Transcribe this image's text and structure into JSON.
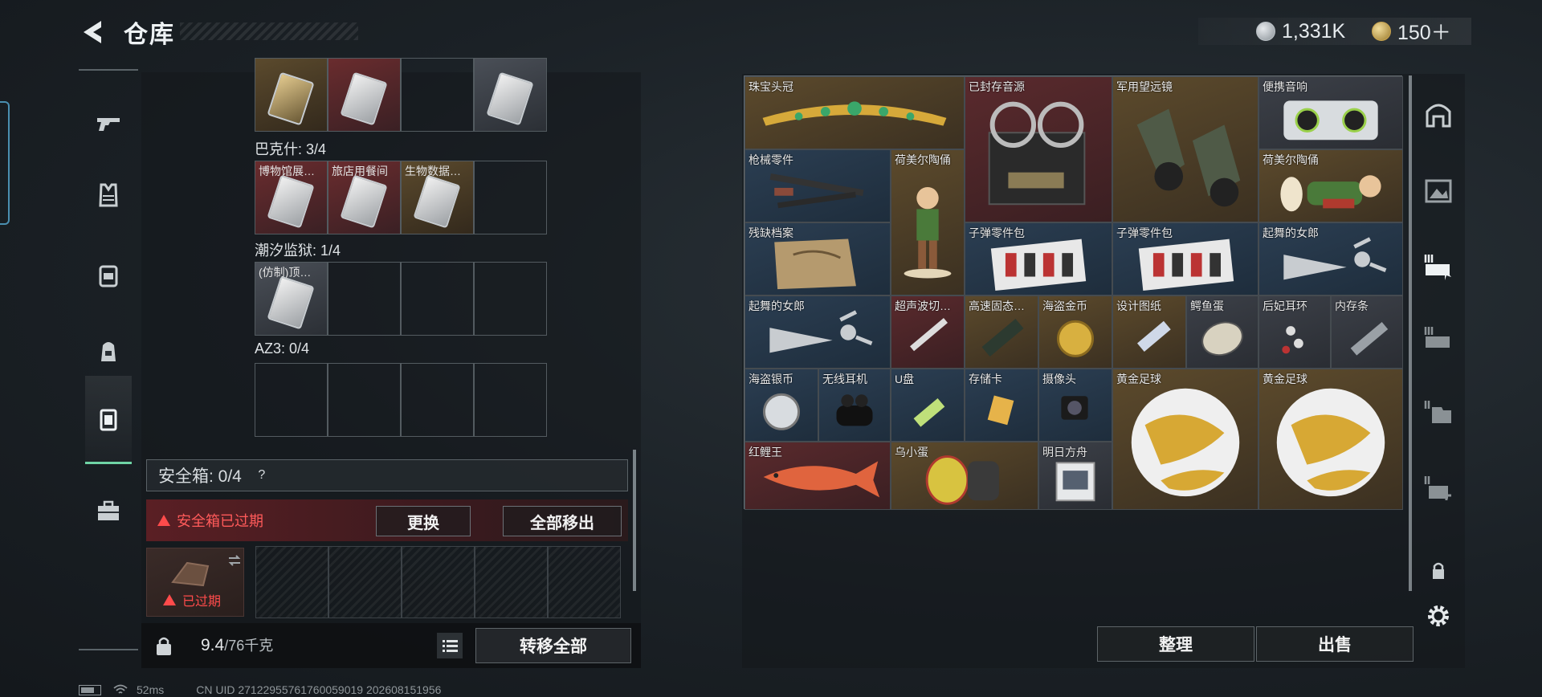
{
  "header": {
    "title": "仓库",
    "currency_silver": "1,331K",
    "currency_gold": "150＋"
  },
  "left_panel": {
    "rows": [
      {
        "title": "巴克什: 3/4",
        "slots": [
          {
            "label": "博物馆展…",
            "tone": "red"
          },
          {
            "label": "旅店用餐间",
            "tone": "red"
          },
          {
            "label": "生物数据…",
            "tone": "gold"
          },
          {
            "label": "",
            "tone": "empty"
          }
        ]
      },
      {
        "title": "潮汐监狱: 1/4",
        "slots": [
          {
            "label": "(仿制)顶…",
            "tone": "grey"
          },
          {
            "label": "",
            "tone": "empty"
          },
          {
            "label": "",
            "tone": "empty"
          },
          {
            "label": "",
            "tone": "empty"
          }
        ]
      },
      {
        "title": "AZ3: 0/4"
      }
    ],
    "safe_box_label": "安全箱: 0/4",
    "safe_box_help": "?",
    "expired_warning": "安全箱已过期",
    "replace_button": "更换",
    "move_all_button": "全部移出",
    "expired_tag": "已过期",
    "weight_current": "9.4",
    "weight_max": "/76千克",
    "transfer_all_button": "转移全部"
  },
  "warehouse": {
    "items": [
      {
        "label": "珠宝头冠",
        "tone": "gold",
        "icon": "tiara"
      },
      {
        "label": "已封存音源",
        "tone": "red",
        "icon": "reel-recorder"
      },
      {
        "label": "军用望远镜",
        "tone": "gold",
        "icon": "binoculars"
      },
      {
        "label": "便携音响",
        "tone": "grey",
        "icon": "boombox"
      },
      {
        "label": "枪械零件",
        "tone": "blue",
        "icon": "gun-parts"
      },
      {
        "label": "荷美尔陶俑",
        "tone": "gold",
        "icon": "figurine"
      },
      {
        "label": "荷美尔陶俑",
        "tone": "gold",
        "icon": "figurine-lying"
      },
      {
        "label": "残缺档案",
        "tone": "blue",
        "icon": "archive"
      },
      {
        "label": "子弹零件包",
        "tone": "blue",
        "icon": "bullet-parts"
      },
      {
        "label": "子弹零件包",
        "tone": "blue",
        "icon": "bullet-parts"
      },
      {
        "label": "起舞的女郎",
        "tone": "blue",
        "icon": "dancer"
      },
      {
        "label": "起舞的女郎",
        "tone": "blue",
        "icon": "dancer"
      },
      {
        "label": "超声波切…",
        "tone": "red",
        "icon": "cutter"
      },
      {
        "label": "高速固态…",
        "tone": "gold",
        "icon": "ssd"
      },
      {
        "label": "海盗金币",
        "tone": "gold",
        "icon": "gold-coin"
      },
      {
        "label": "设计图纸",
        "tone": "gold",
        "icon": "blueprint"
      },
      {
        "label": "鳄鱼蛋",
        "tone": "grey",
        "icon": "egg"
      },
      {
        "label": "后妃耳环",
        "tone": "grey",
        "icon": "earring"
      },
      {
        "label": "内存条",
        "tone": "grey",
        "icon": "ram"
      },
      {
        "label": "海盗银币",
        "tone": "blue",
        "icon": "silver-coin"
      },
      {
        "label": "无线耳机",
        "tone": "blue",
        "icon": "earbuds"
      },
      {
        "label": "U盘",
        "tone": "blue",
        "icon": "usb"
      },
      {
        "label": "存储卡",
        "tone": "blue",
        "icon": "sd-card"
      },
      {
        "label": "摄像头",
        "tone": "blue",
        "icon": "camera"
      },
      {
        "label": "黄金足球",
        "tone": "gold",
        "icon": "gold-football"
      },
      {
        "label": "黄金足球",
        "tone": "gold",
        "icon": "gold-football"
      },
      {
        "label": "红鲤王",
        "tone": "red",
        "icon": "carp"
      },
      {
        "label": "乌小蛋",
        "tone": "gold",
        "icon": "painted-egg"
      },
      {
        "label": "明日方舟",
        "tone": "grey",
        "icon": "card-pack"
      }
    ],
    "sort_button": "整理",
    "sell_button": "出售"
  },
  "status": {
    "ping": "52ms",
    "uid": "CN UID 2712295576176005901​9 202608151956"
  },
  "colors": {
    "accent_green": "#6fd3a5",
    "warning_red": "#ff4b4b",
    "gold_cell": "#5c4a2c",
    "red_cell": "#5a2a2d",
    "blue_cell": "#2b3e52"
  }
}
